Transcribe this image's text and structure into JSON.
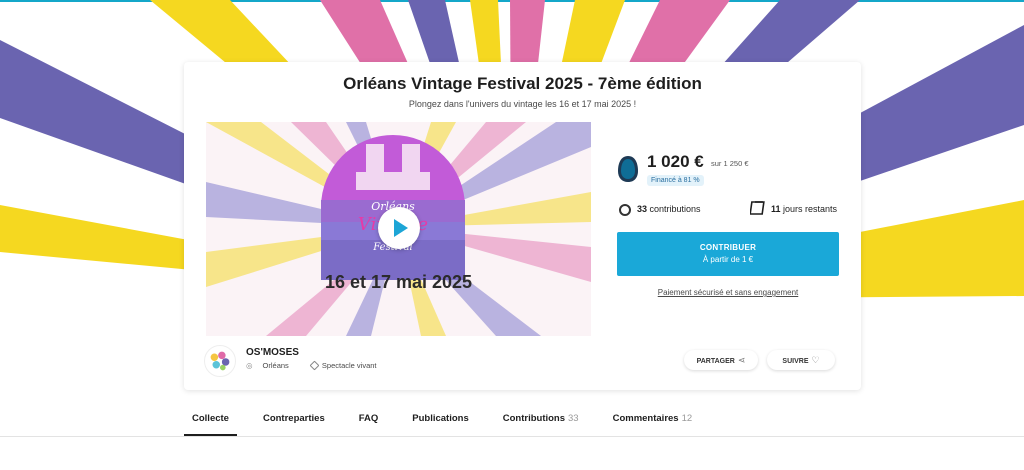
{
  "project": {
    "title": "Orléans Vintage Festival 2025 - 7ème édition",
    "subtitle": "Plongez dans l'univers du vintage les 16 et 17 mai 2025 !",
    "visual": {
      "logo_line1": "Orléans",
      "logo_line2": "Vintage",
      "logo_line3": "Festival",
      "dates": "16 et 17 mai 2025"
    }
  },
  "funding": {
    "amount": "1 020 €",
    "goal": "sur 1 250 €",
    "funded_badge": "Financé à 81 %",
    "funded_percent": 81,
    "contributions_count": "33",
    "contributions_label": "contributions",
    "days_count": "11",
    "days_label": "jours restants",
    "cta_line1": "CONTRIBUER",
    "cta_line2": "À partir de 1 €",
    "secure_text": "Paiement sécurisé et sans engagement"
  },
  "owner": {
    "name": "OS'MOSES",
    "location": "Orléans",
    "category": "Spectacle vivant"
  },
  "actions": {
    "share_label": "PARTAGER",
    "follow_label": "SUIVRE"
  },
  "tabs": [
    {
      "label": "Collecte",
      "count": ""
    },
    {
      "label": "Contreparties",
      "count": ""
    },
    {
      "label": "FAQ",
      "count": ""
    },
    {
      "label": "Publications",
      "count": ""
    },
    {
      "label": "Contributions",
      "count": "33"
    },
    {
      "label": "Commentaires",
      "count": "12"
    }
  ],
  "colors": {
    "accent": "#1aa8d8",
    "ray_yellow": "#f5d820",
    "ray_purple": "#6a64b0",
    "ray_pink": "#e070a8"
  },
  "icons": {
    "goal": "piggy-bank-icon",
    "contributions": "contributors-icon",
    "days": "calendar-icon",
    "share": "share-icon",
    "follow": "heart-icon",
    "play": "play-icon"
  }
}
